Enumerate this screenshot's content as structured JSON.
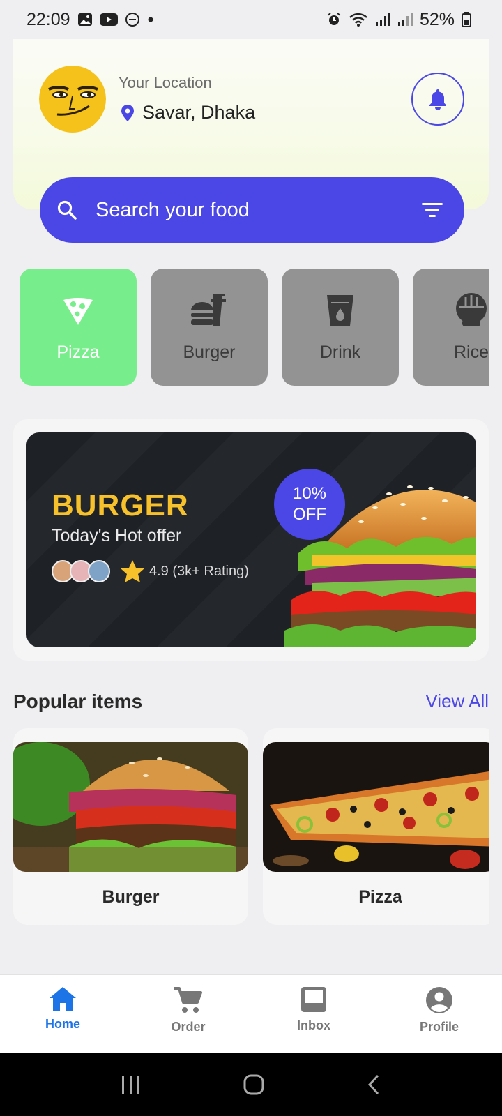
{
  "status_bar": {
    "time": "22:09",
    "battery": "52%"
  },
  "header": {
    "location_label": "Your Location",
    "location_value": "Savar, Dhaka"
  },
  "search": {
    "placeholder": "Search your food"
  },
  "categories": [
    {
      "label": "Pizza",
      "icon": "pizza-icon",
      "active": true
    },
    {
      "label": "Burger",
      "icon": "fastfood-icon",
      "active": false
    },
    {
      "label": "Drink",
      "icon": "drink-icon",
      "active": false
    },
    {
      "label": "Rice",
      "icon": "rice-bowl-icon",
      "active": false
    }
  ],
  "promo": {
    "title": "BURGER",
    "subtitle": "Today's Hot offer",
    "rating": "4.9 (3k+ Rating)",
    "discount_line1": "10%",
    "discount_line2": "OFF"
  },
  "popular": {
    "title": "Popular items",
    "view_all": "View All",
    "items": [
      {
        "name": "Burger"
      },
      {
        "name": "Pizza"
      }
    ]
  },
  "bottom_nav": [
    {
      "label": "Home",
      "icon": "home-icon",
      "active": true
    },
    {
      "label": "Order",
      "icon": "cart-icon",
      "active": false
    },
    {
      "label": "Inbox",
      "icon": "inbox-icon",
      "active": false
    },
    {
      "label": "Profile",
      "icon": "account-circle-icon",
      "active": false
    }
  ],
  "colors": {
    "accent": "#4b47e6",
    "category_active": "#77ee8b",
    "category_inactive": "#939393",
    "promo_title": "#f6c12b",
    "nav_active": "#1d74e7"
  }
}
